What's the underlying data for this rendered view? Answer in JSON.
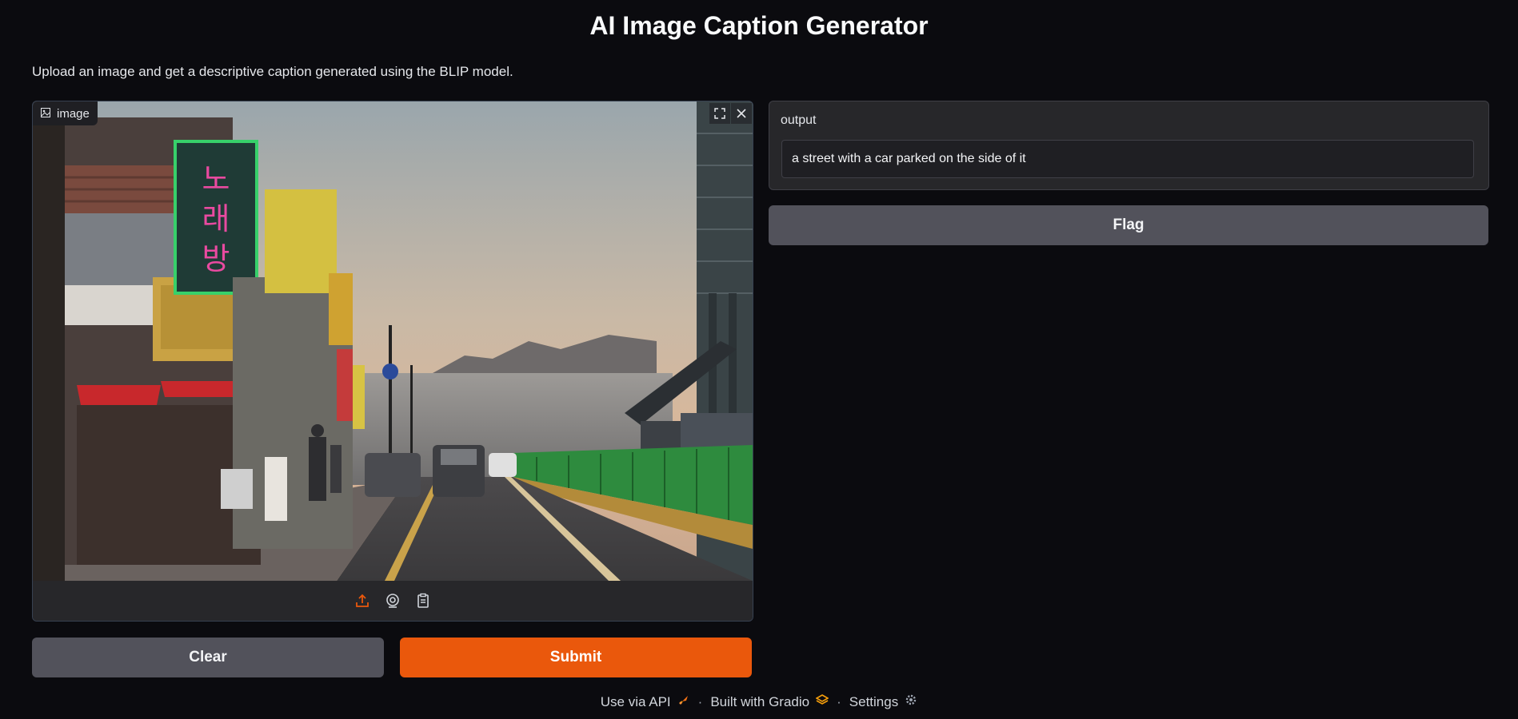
{
  "title": "AI Image Caption Generator",
  "description": "Upload an image and get a descriptive caption generated using the BLIP model.",
  "input": {
    "label": "image",
    "sources": [
      "upload-icon",
      "webcam-icon",
      "clipboard-icon"
    ],
    "active_source_color": "#ea580c"
  },
  "buttons": {
    "clear": "Clear",
    "submit": "Submit",
    "flag": "Flag"
  },
  "output": {
    "label": "output",
    "value": "a street with a car parked on the side of it"
  },
  "footer": {
    "api": "Use via API",
    "separator": "·",
    "built_with": "Built with Gradio",
    "settings": "Settings"
  },
  "colors": {
    "accent": "#ea580c",
    "background": "#0b0b0f",
    "panel": "#27272a",
    "secondary_button": "#52525b"
  }
}
